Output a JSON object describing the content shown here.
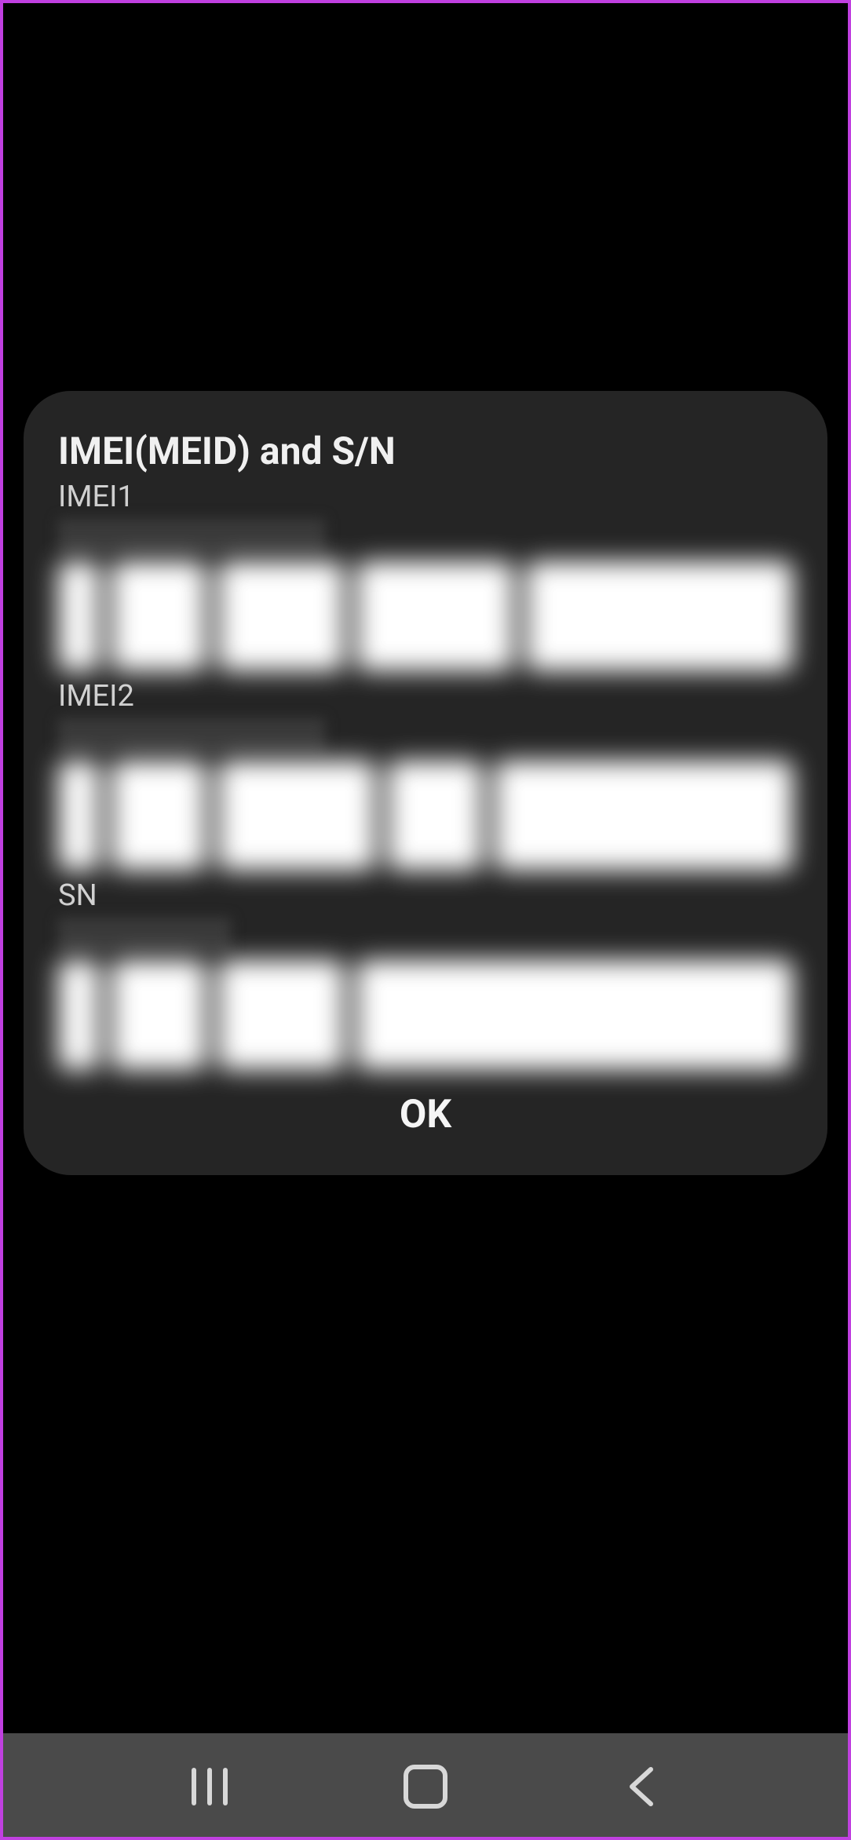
{
  "dialog": {
    "title": "IMEI(MEID) and S/N",
    "imei1_label": "IMEI1",
    "imei2_label": "IMEI2",
    "sn_label": "SN",
    "ok_label": "OK"
  }
}
